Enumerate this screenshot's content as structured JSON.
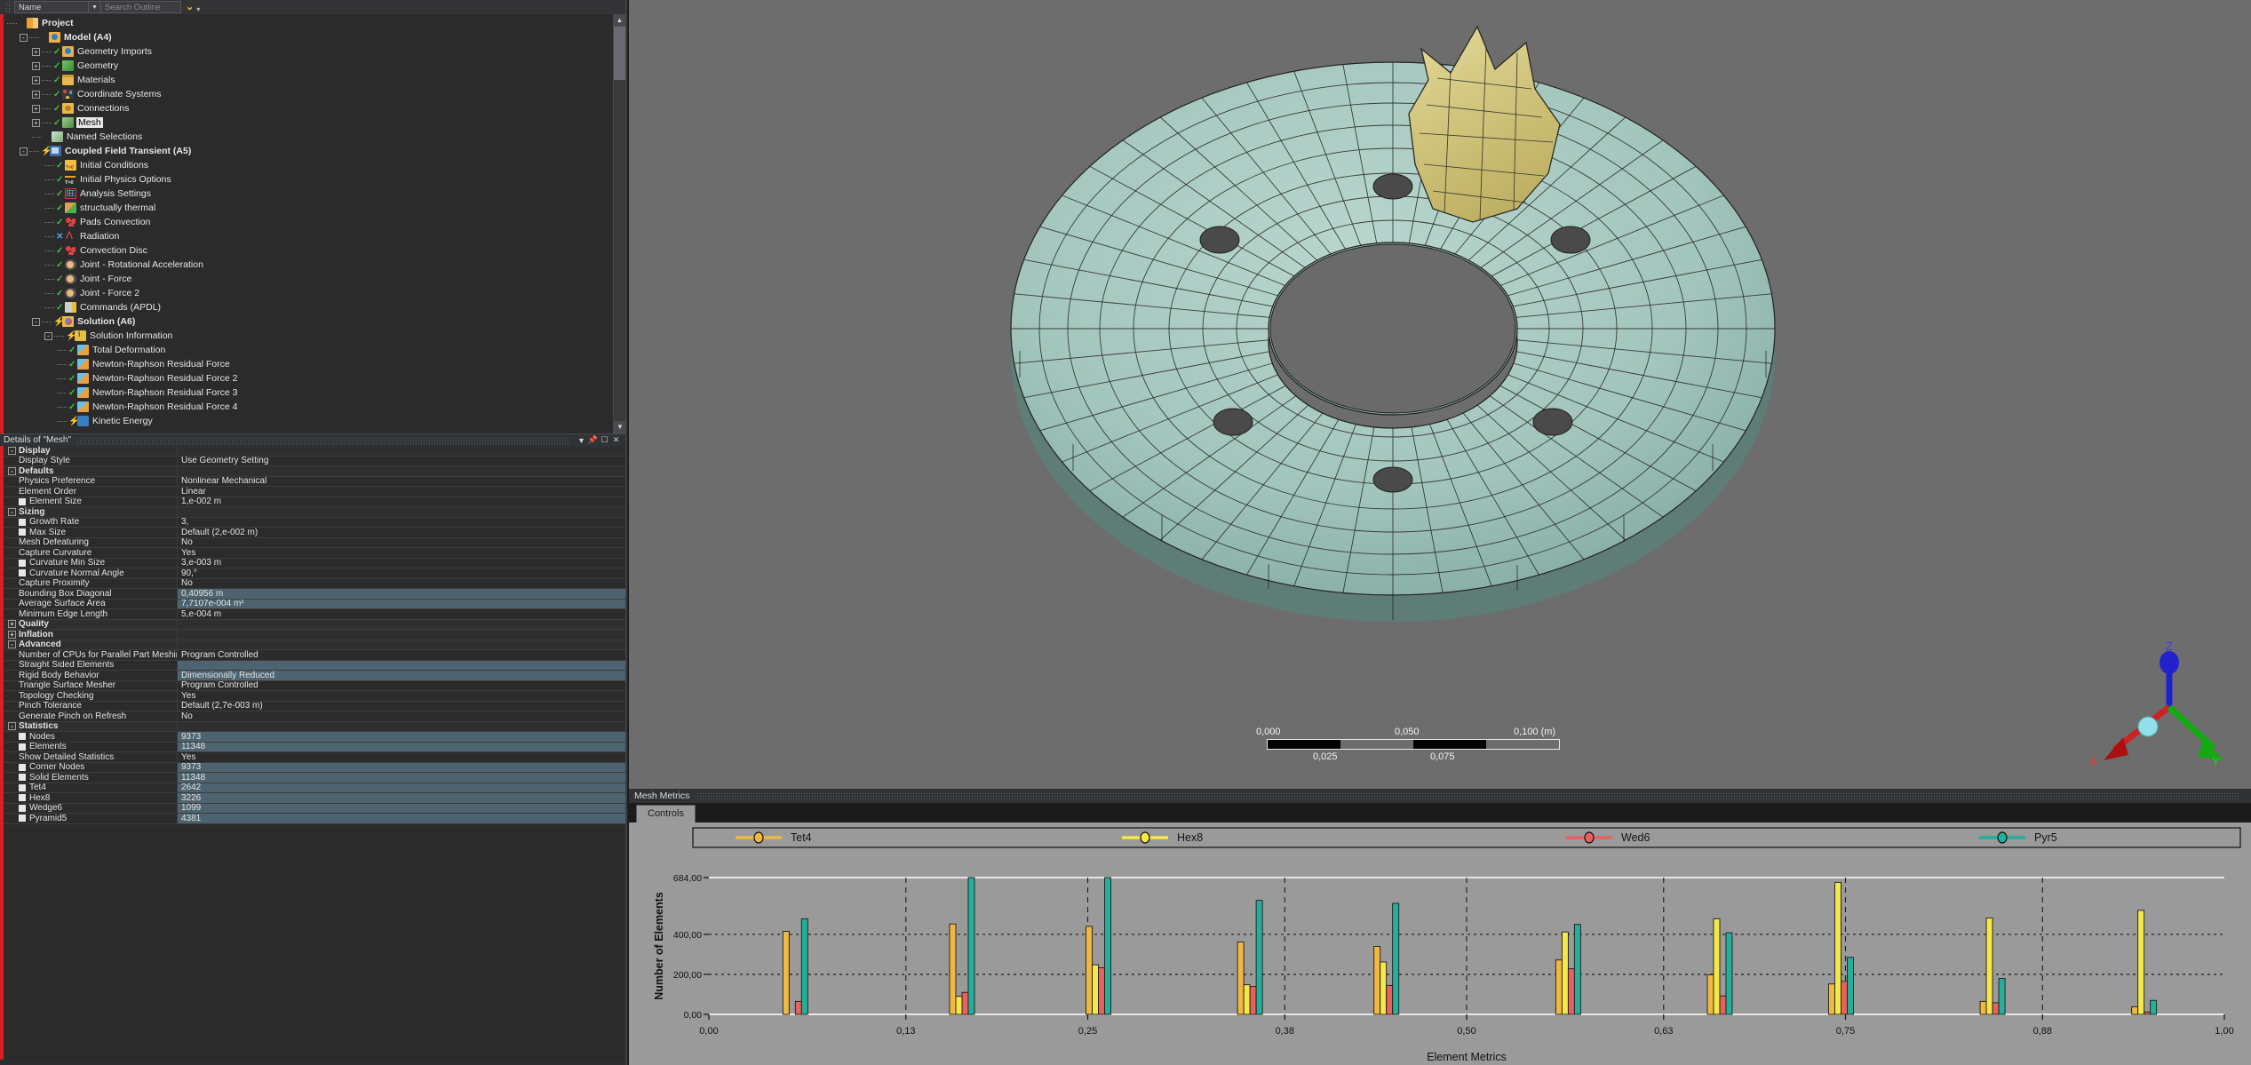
{
  "outline_toolbar": {
    "name_label": "Name",
    "search_placeholder": "Search Outline",
    "dropdown_icon": "chevron-down-icon",
    "filter_icon": "chevron-yellow-icon"
  },
  "tree": {
    "items": [
      {
        "label": "Project",
        "depth": 0,
        "icon": "project-icon",
        "expander": "",
        "mark": "",
        "bold": true,
        "selected": false
      },
      {
        "label": "Model (A4)",
        "depth": 1,
        "icon": "model-icon",
        "expander": "-",
        "mark": "",
        "bold": true,
        "selected": false
      },
      {
        "label": "Geometry Imports",
        "depth": 2,
        "icon": "geomimport-icon",
        "expander": "+",
        "mark": "check",
        "bold": false,
        "selected": false
      },
      {
        "label": "Geometry",
        "depth": 2,
        "icon": "geometry-icon",
        "expander": "+",
        "mark": "check",
        "bold": false,
        "selected": false
      },
      {
        "label": "Materials",
        "depth": 2,
        "icon": "materials-icon",
        "expander": "+",
        "mark": "check",
        "bold": false,
        "selected": false
      },
      {
        "label": "Coordinate Systems",
        "depth": 2,
        "icon": "coordsys-icon",
        "expander": "+",
        "mark": "check",
        "bold": false,
        "selected": false
      },
      {
        "label": "Connections",
        "depth": 2,
        "icon": "connections-icon",
        "expander": "+",
        "mark": "check",
        "bold": false,
        "selected": false
      },
      {
        "label": "Mesh",
        "depth": 2,
        "icon": "mesh-icon",
        "expander": "+",
        "mark": "check",
        "bold": false,
        "selected": true
      },
      {
        "label": "Named Selections",
        "depth": 2,
        "icon": "namedsel-icon",
        "expander": "",
        "mark": "",
        "bold": false,
        "selected": false
      },
      {
        "label": "Coupled Field Transient (A5)",
        "depth": 1,
        "icon": "analysis-icon",
        "expander": "-",
        "mark": "bolt",
        "bold": true,
        "selected": false
      },
      {
        "label": "Initial Conditions",
        "depth": 3,
        "icon": "initcond-icon",
        "expander": "",
        "mark": "check",
        "bold": false,
        "selected": false
      },
      {
        "label": "Initial Physics Options",
        "depth": 3,
        "icon": "physicsopt-icon",
        "expander": "",
        "mark": "check",
        "bold": false,
        "selected": false
      },
      {
        "label": "Analysis Settings",
        "depth": 3,
        "icon": "analysissettings-icon",
        "expander": "",
        "mark": "check",
        "bold": false,
        "selected": false
      },
      {
        "label": "structually thermal",
        "depth": 3,
        "icon": "structthermal-icon",
        "expander": "",
        "mark": "check",
        "bold": false,
        "selected": false
      },
      {
        "label": "Pads Convection",
        "depth": 3,
        "icon": "convection-icon",
        "expander": "",
        "mark": "check",
        "bold": false,
        "selected": false
      },
      {
        "label": "Radiation",
        "depth": 3,
        "icon": "radiation-icon",
        "expander": "",
        "mark": "x",
        "bold": false,
        "selected": false
      },
      {
        "label": "Convection Disc",
        "depth": 3,
        "icon": "convection-icon",
        "expander": "",
        "mark": "check",
        "bold": false,
        "selected": false
      },
      {
        "label": "Joint - Rotational Acceleration",
        "depth": 3,
        "icon": "joint-icon",
        "expander": "",
        "mark": "check",
        "bold": false,
        "selected": false
      },
      {
        "label": "Joint - Force",
        "depth": 3,
        "icon": "joint-icon",
        "expander": "",
        "mark": "check",
        "bold": false,
        "selected": false
      },
      {
        "label": "Joint - Force 2",
        "depth": 3,
        "icon": "joint-icon",
        "expander": "",
        "mark": "check",
        "bold": false,
        "selected": false
      },
      {
        "label": "Commands (APDL)",
        "depth": 3,
        "icon": "commands-icon",
        "expander": "",
        "mark": "check",
        "bold": false,
        "selected": false
      },
      {
        "label": "Solution (A6)",
        "depth": 2,
        "icon": "solution-icon",
        "expander": "-",
        "mark": "bolt",
        "bold": true,
        "selected": false
      },
      {
        "label": "Solution Information",
        "depth": 3,
        "icon": "solinfo-icon",
        "expander": "-",
        "mark": "bolt",
        "bold": false,
        "selected": false
      },
      {
        "label": "Total Deformation",
        "depth": 4,
        "icon": "result-icon",
        "expander": "",
        "mark": "check",
        "bold": false,
        "selected": false
      },
      {
        "label": "Newton-Raphson Residual Force",
        "depth": 4,
        "icon": "result-icon",
        "expander": "",
        "mark": "check",
        "bold": false,
        "selected": false
      },
      {
        "label": "Newton-Raphson Residual Force 2",
        "depth": 4,
        "icon": "result-icon",
        "expander": "",
        "mark": "check",
        "bold": false,
        "selected": false
      },
      {
        "label": "Newton-Raphson Residual Force 3",
        "depth": 4,
        "icon": "result-icon",
        "expander": "",
        "mark": "check",
        "bold": false,
        "selected": false
      },
      {
        "label": "Newton-Raphson Residual Force 4",
        "depth": 4,
        "icon": "result-icon",
        "expander": "",
        "mark": "check",
        "bold": false,
        "selected": false
      },
      {
        "label": "Kinetic Energy",
        "depth": 4,
        "icon": "kinetic-icon",
        "expander": "",
        "mark": "bolt",
        "bold": false,
        "selected": false
      }
    ]
  },
  "details_panel": {
    "title": "Details of \"Mesh\"",
    "buttons": [
      "chevron-down-icon",
      "pin-icon",
      "maximize-icon",
      "close-icon"
    ],
    "rows": [
      {
        "type": "cat",
        "key": "Display",
        "value": "",
        "expander": "-"
      },
      {
        "type": "prop",
        "key": "Display Style",
        "value": "Use Geometry Setting"
      },
      {
        "type": "cat",
        "key": "Defaults",
        "value": "",
        "expander": "-"
      },
      {
        "type": "prop",
        "key": "Physics Preference",
        "value": "Nonlinear Mechanical"
      },
      {
        "type": "prop",
        "key": "Element Order",
        "value": "Linear"
      },
      {
        "type": "prop",
        "key": "Element Size",
        "value": "1,e-002 m",
        "square": true
      },
      {
        "type": "cat",
        "key": "Sizing",
        "value": "",
        "expander": "-"
      },
      {
        "type": "prop",
        "key": "Growth Rate",
        "value": "3,",
        "square": true
      },
      {
        "type": "prop",
        "key": "Max Size",
        "value": "Default (2,e-002 m)",
        "square": true
      },
      {
        "type": "prop",
        "key": "Mesh Defeaturing",
        "value": "No"
      },
      {
        "type": "prop",
        "key": "Capture Curvature",
        "value": "Yes"
      },
      {
        "type": "prop",
        "key": "Curvature Min Size",
        "value": "3,e-003 m",
        "square": true
      },
      {
        "type": "prop",
        "key": "Curvature Normal Angle",
        "value": "90,°",
        "square": true
      },
      {
        "type": "prop",
        "key": "Capture Proximity",
        "value": "No"
      },
      {
        "type": "prop",
        "key": "Bounding Box Diagonal",
        "value": "0,40956 m",
        "highlight": true
      },
      {
        "type": "prop",
        "key": "Average Surface Area",
        "value": "7,7107e-004 m²",
        "highlight": true
      },
      {
        "type": "prop",
        "key": "Minimum Edge Length",
        "value": "5,e-004 m"
      },
      {
        "type": "cat",
        "key": "Quality",
        "value": "",
        "expander": "+"
      },
      {
        "type": "cat",
        "key": "Inflation",
        "value": "",
        "expander": "+"
      },
      {
        "type": "cat",
        "key": "Advanced",
        "value": "",
        "expander": "-"
      },
      {
        "type": "prop",
        "key": "Number of CPUs for Parallel Part Meshing",
        "value": "Program Controlled"
      },
      {
        "type": "prop",
        "key": "Straight Sided Elements",
        "value": "",
        "highlight": true
      },
      {
        "type": "prop",
        "key": "Rigid Body Behavior",
        "value": "Dimensionally Reduced",
        "highlight": true
      },
      {
        "type": "prop",
        "key": "Triangle Surface Mesher",
        "value": "Program Controlled"
      },
      {
        "type": "prop",
        "key": "Topology Checking",
        "value": "Yes"
      },
      {
        "type": "prop",
        "key": "Pinch Tolerance",
        "value": "Default (2,7e-003 m)"
      },
      {
        "type": "prop",
        "key": "Generate Pinch on Refresh",
        "value": "No"
      },
      {
        "type": "cat",
        "key": "Statistics",
        "value": "",
        "expander": "-"
      },
      {
        "type": "prop",
        "key": "Nodes",
        "value": "9373",
        "square": true,
        "highlight": true
      },
      {
        "type": "prop",
        "key": "Elements",
        "value": "11348",
        "square": true,
        "highlight": true
      },
      {
        "type": "prop",
        "key": "Show Detailed Statistics",
        "value": "Yes"
      },
      {
        "type": "prop",
        "key": "Corner Nodes",
        "value": "9373",
        "square": true,
        "highlight": true
      },
      {
        "type": "prop",
        "key": "Solid Elements",
        "value": "11348",
        "square": true,
        "highlight": true
      },
      {
        "type": "prop",
        "key": "Tet4",
        "value": "2642",
        "square": true,
        "highlight": true
      },
      {
        "type": "prop",
        "key": "Hex8",
        "value": "3226",
        "square": true,
        "highlight": true
      },
      {
        "type": "prop",
        "key": "Wedge6",
        "value": "1099",
        "square": true,
        "highlight": true
      },
      {
        "type": "prop",
        "key": "Pyramid5",
        "value": "4381",
        "square": true,
        "highlight": true
      }
    ]
  },
  "viewport": {
    "scalebar": {
      "ticks": [
        "0,000",
        "0,050",
        "0,100 (m)"
      ],
      "subticks": [
        "0,025",
        "0,075"
      ],
      "segments": [
        1,
        0,
        1,
        0
      ]
    },
    "triad": {
      "x_label": "X",
      "y_label": "Y",
      "z_label": "Z"
    },
    "colors": {
      "background": "#6d6d6d",
      "disc": "#9fc5bd",
      "pad": "#d7cc88",
      "mesh_line": "#1e1e1e"
    }
  },
  "mesh_metrics": {
    "panel_title": "Mesh Metrics",
    "tab_label": "Controls"
  },
  "chart_data": {
    "type": "bar",
    "title": "",
    "xlabel": "Element Metrics",
    "ylabel": "Number of Elements",
    "xlim": [
      0.0,
      1.0
    ],
    "ylim": [
      0.0,
      684.0
    ],
    "xticks": [
      "0,00",
      "0,13",
      "0,25",
      "0,38",
      "0,50",
      "0,63",
      "0,75",
      "0,88",
      "1,00"
    ],
    "xtick_values": [
      0.0,
      0.13,
      0.25,
      0.38,
      0.5,
      0.63,
      0.75,
      0.88,
      1.0
    ],
    "yticks": [
      "0,00",
      "200,00",
      "400,00",
      "684,00"
    ],
    "ytick_values": [
      0,
      200,
      400,
      684
    ],
    "grid": true,
    "legend_position": "top",
    "legend": [
      {
        "name": "Tet4",
        "color": "#f0b840"
      },
      {
        "name": "Hex8",
        "color": "#f2e84a"
      },
      {
        "name": "Wed6",
        "color": "#e8605f"
      },
      {
        "name": "Pyr5",
        "color": "#22b09a"
      }
    ],
    "groups": [
      {
        "x": 0.055,
        "Tet4": 415,
        "Hex8": 0,
        "Wed6": 65,
        "Pyr5": 478
      },
      {
        "x": 0.165,
        "Tet4": 452,
        "Hex8": 90,
        "Wed6": 110,
        "Pyr5": 684
      },
      {
        "x": 0.255,
        "Tet4": 440,
        "Hex8": 248,
        "Wed6": 233,
        "Pyr5": 684
      },
      {
        "x": 0.355,
        "Tet4": 362,
        "Hex8": 148,
        "Wed6": 140,
        "Pyr5": 570
      },
      {
        "x": 0.445,
        "Tet4": 340,
        "Hex8": 262,
        "Wed6": 145,
        "Pyr5": 555
      },
      {
        "x": 0.565,
        "Tet4": 272,
        "Hex8": 412,
        "Wed6": 228,
        "Pyr5": 450
      },
      {
        "x": 0.665,
        "Tet4": 198,
        "Hex8": 478,
        "Wed6": 92,
        "Pyr5": 408
      },
      {
        "x": 0.745,
        "Tet4": 152,
        "Hex8": 660,
        "Wed6": 165,
        "Pyr5": 285
      },
      {
        "x": 0.845,
        "Tet4": 65,
        "Hex8": 482,
        "Wed6": 58,
        "Pyr5": 180
      },
      {
        "x": 0.945,
        "Tet4": 38,
        "Hex8": 520,
        "Wed6": 12,
        "Pyr5": 70
      }
    ]
  }
}
